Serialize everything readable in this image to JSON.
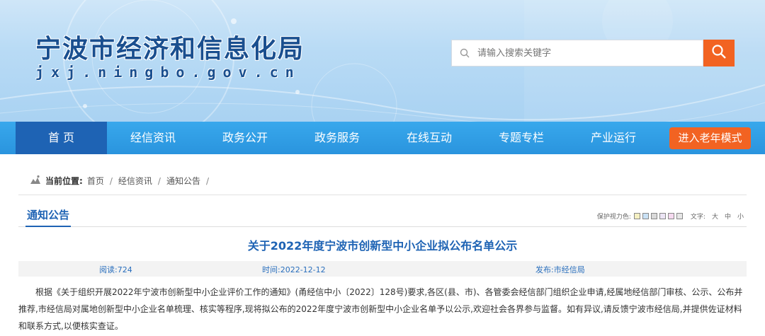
{
  "header": {
    "site_title": "宁波市经济和信息化局",
    "site_domain": "jxj.ningbo.gov.cn",
    "search": {
      "placeholder": "请输入搜索关键字",
      "icon": "search-icon"
    },
    "colors": {
      "accent": "#f26322",
      "brand_blue": "#1e63b4",
      "nav_blue": "#2a94de"
    }
  },
  "nav": {
    "items": [
      "首 页",
      "经信资讯",
      "政务公开",
      "政务服务",
      "在线互动",
      "专题专栏",
      "产业运行"
    ],
    "elder_mode": "进入老年模式"
  },
  "breadcrumb": {
    "label": "当前位置:",
    "items": [
      "首页",
      "经信资讯",
      "通知公告"
    ]
  },
  "section": {
    "tab": "通知公告",
    "protect_label": "保护视力色:",
    "swatches": [
      "#f5f0c2",
      "#c9e1f5",
      "#d9d9d9",
      "#ece5f5",
      "#f5d9ef",
      "#e6e6e6"
    ],
    "font_label": "文字:",
    "font_sizes": [
      "大",
      "中",
      "小"
    ]
  },
  "article": {
    "title": "关于2022年度宁波市创新型中小企业拟公布名单公示",
    "reads": "阅读:724",
    "time": "时间:2022-12-12",
    "publisher": "发布:市经信局",
    "body": "根据《关于组织开展2022年宁波市创新型中小企业评价工作的通知》(甬经信中小〔2022〕128号)要求,各区(县、市)、各管委会经信部门组织企业申请,经属地经信部门审核、公示、公布并推荐,市经信局对属地创新型中小企业名单梳理、核实等程序,现将拟公布的2022年度宁波市创新型中小企业名单予以公示,欢迎社会各界参与监督。如有异议,请反馈宁波市经信局,并提供佐证材料和联系方式,以便核实查证。"
  }
}
